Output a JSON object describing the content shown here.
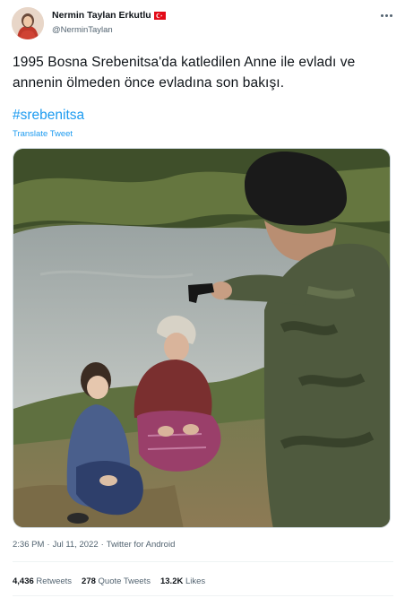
{
  "author": {
    "name": "Nermin Taylan Erkutlu",
    "handle": "@NerminTaylan",
    "flag": "turkey-flag-icon"
  },
  "tweet": {
    "text_line1": "1995 Bosna Srebenitsa'da katledilen Anne ile evladı ve",
    "text_line2": "annenin ölmeden önce evladına son bakışı.",
    "hashtag": "#srebenitsa",
    "translate_label": "Translate Tweet"
  },
  "meta": {
    "time": "2:36 PM",
    "separator1": "·",
    "date": "Jul 11, 2022",
    "separator2": "·",
    "source": "Twitter for Android"
  },
  "stats": {
    "retweets_count": "4,436",
    "retweets_label": "Retweets",
    "quotes_count": "278",
    "quotes_label": "Quote Tweets",
    "likes_count": "13.2K",
    "likes_label": "Likes"
  },
  "colors": {
    "link": "#1d9bf0",
    "secondary": "#536471",
    "primary_text": "#0f1419"
  }
}
